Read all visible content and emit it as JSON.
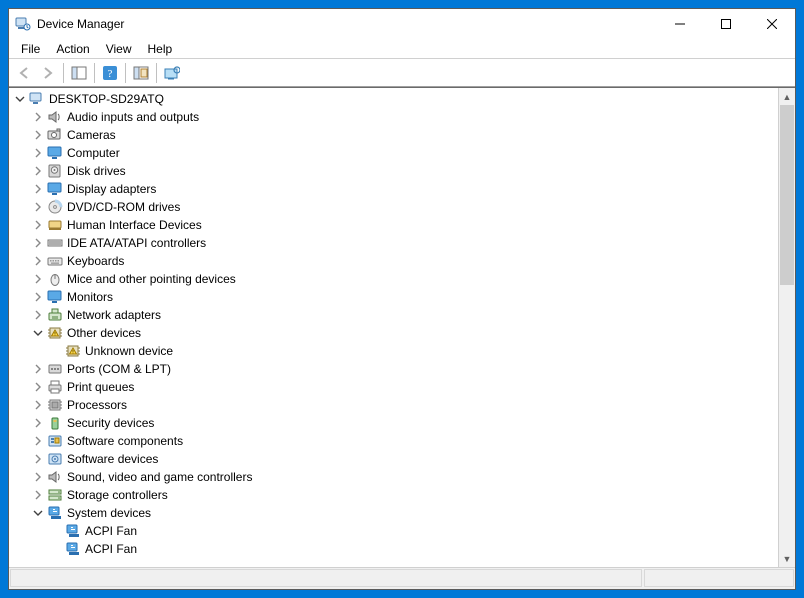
{
  "window": {
    "title": "Device Manager"
  },
  "menu": {
    "file": "File",
    "action": "Action",
    "view": "View",
    "help": "Help"
  },
  "tree": {
    "root": "DESKTOP-SD29ATQ",
    "categories": [
      {
        "id": "audio",
        "label": "Audio inputs and outputs",
        "expanded": false
      },
      {
        "id": "cameras",
        "label": "Cameras",
        "expanded": false
      },
      {
        "id": "computer",
        "label": "Computer",
        "expanded": false
      },
      {
        "id": "disk",
        "label": "Disk drives",
        "expanded": false
      },
      {
        "id": "display",
        "label": "Display adapters",
        "expanded": false
      },
      {
        "id": "dvd",
        "label": "DVD/CD-ROM drives",
        "expanded": false
      },
      {
        "id": "hid",
        "label": "Human Interface Devices",
        "expanded": false
      },
      {
        "id": "ide",
        "label": "IDE ATA/ATAPI controllers",
        "expanded": false
      },
      {
        "id": "keyboards",
        "label": "Keyboards",
        "expanded": false
      },
      {
        "id": "mice",
        "label": "Mice and other pointing devices",
        "expanded": false
      },
      {
        "id": "monitors",
        "label": "Monitors",
        "expanded": false
      },
      {
        "id": "network",
        "label": "Network adapters",
        "expanded": false
      },
      {
        "id": "other",
        "label": "Other devices",
        "expanded": true,
        "children": [
          {
            "id": "unknown",
            "label": "Unknown device",
            "warn": true
          }
        ]
      },
      {
        "id": "ports",
        "label": "Ports (COM & LPT)",
        "expanded": false
      },
      {
        "id": "print",
        "label": "Print queues",
        "expanded": false
      },
      {
        "id": "processors",
        "label": "Processors",
        "expanded": false
      },
      {
        "id": "security",
        "label": "Security devices",
        "expanded": false
      },
      {
        "id": "swcomp",
        "label": "Software components",
        "expanded": false
      },
      {
        "id": "swdev",
        "label": "Software devices",
        "expanded": false
      },
      {
        "id": "sound",
        "label": "Sound, video and game controllers",
        "expanded": false
      },
      {
        "id": "storage",
        "label": "Storage controllers",
        "expanded": false
      },
      {
        "id": "system",
        "label": "System devices",
        "expanded": true,
        "children": [
          {
            "id": "acpifan1",
            "label": "ACPI Fan"
          },
          {
            "id": "acpifan2",
            "label": "ACPI Fan"
          }
        ]
      }
    ]
  },
  "icons": {
    "audio": "speaker",
    "cameras": "camera",
    "computer": "monitor",
    "disk": "disk",
    "display": "monitor",
    "dvd": "disc",
    "hid": "hid",
    "ide": "ide",
    "keyboards": "keyboard",
    "mice": "mouse",
    "monitors": "monitor",
    "network": "network",
    "other": "chip-warn",
    "ports": "port",
    "print": "printer",
    "processors": "cpu",
    "security": "security",
    "swcomp": "swcomp",
    "swdev": "swdev",
    "sound": "speaker",
    "storage": "storage",
    "system": "system",
    "unknown": "chip-warn",
    "acpifan1": "system",
    "acpifan2": "system"
  }
}
